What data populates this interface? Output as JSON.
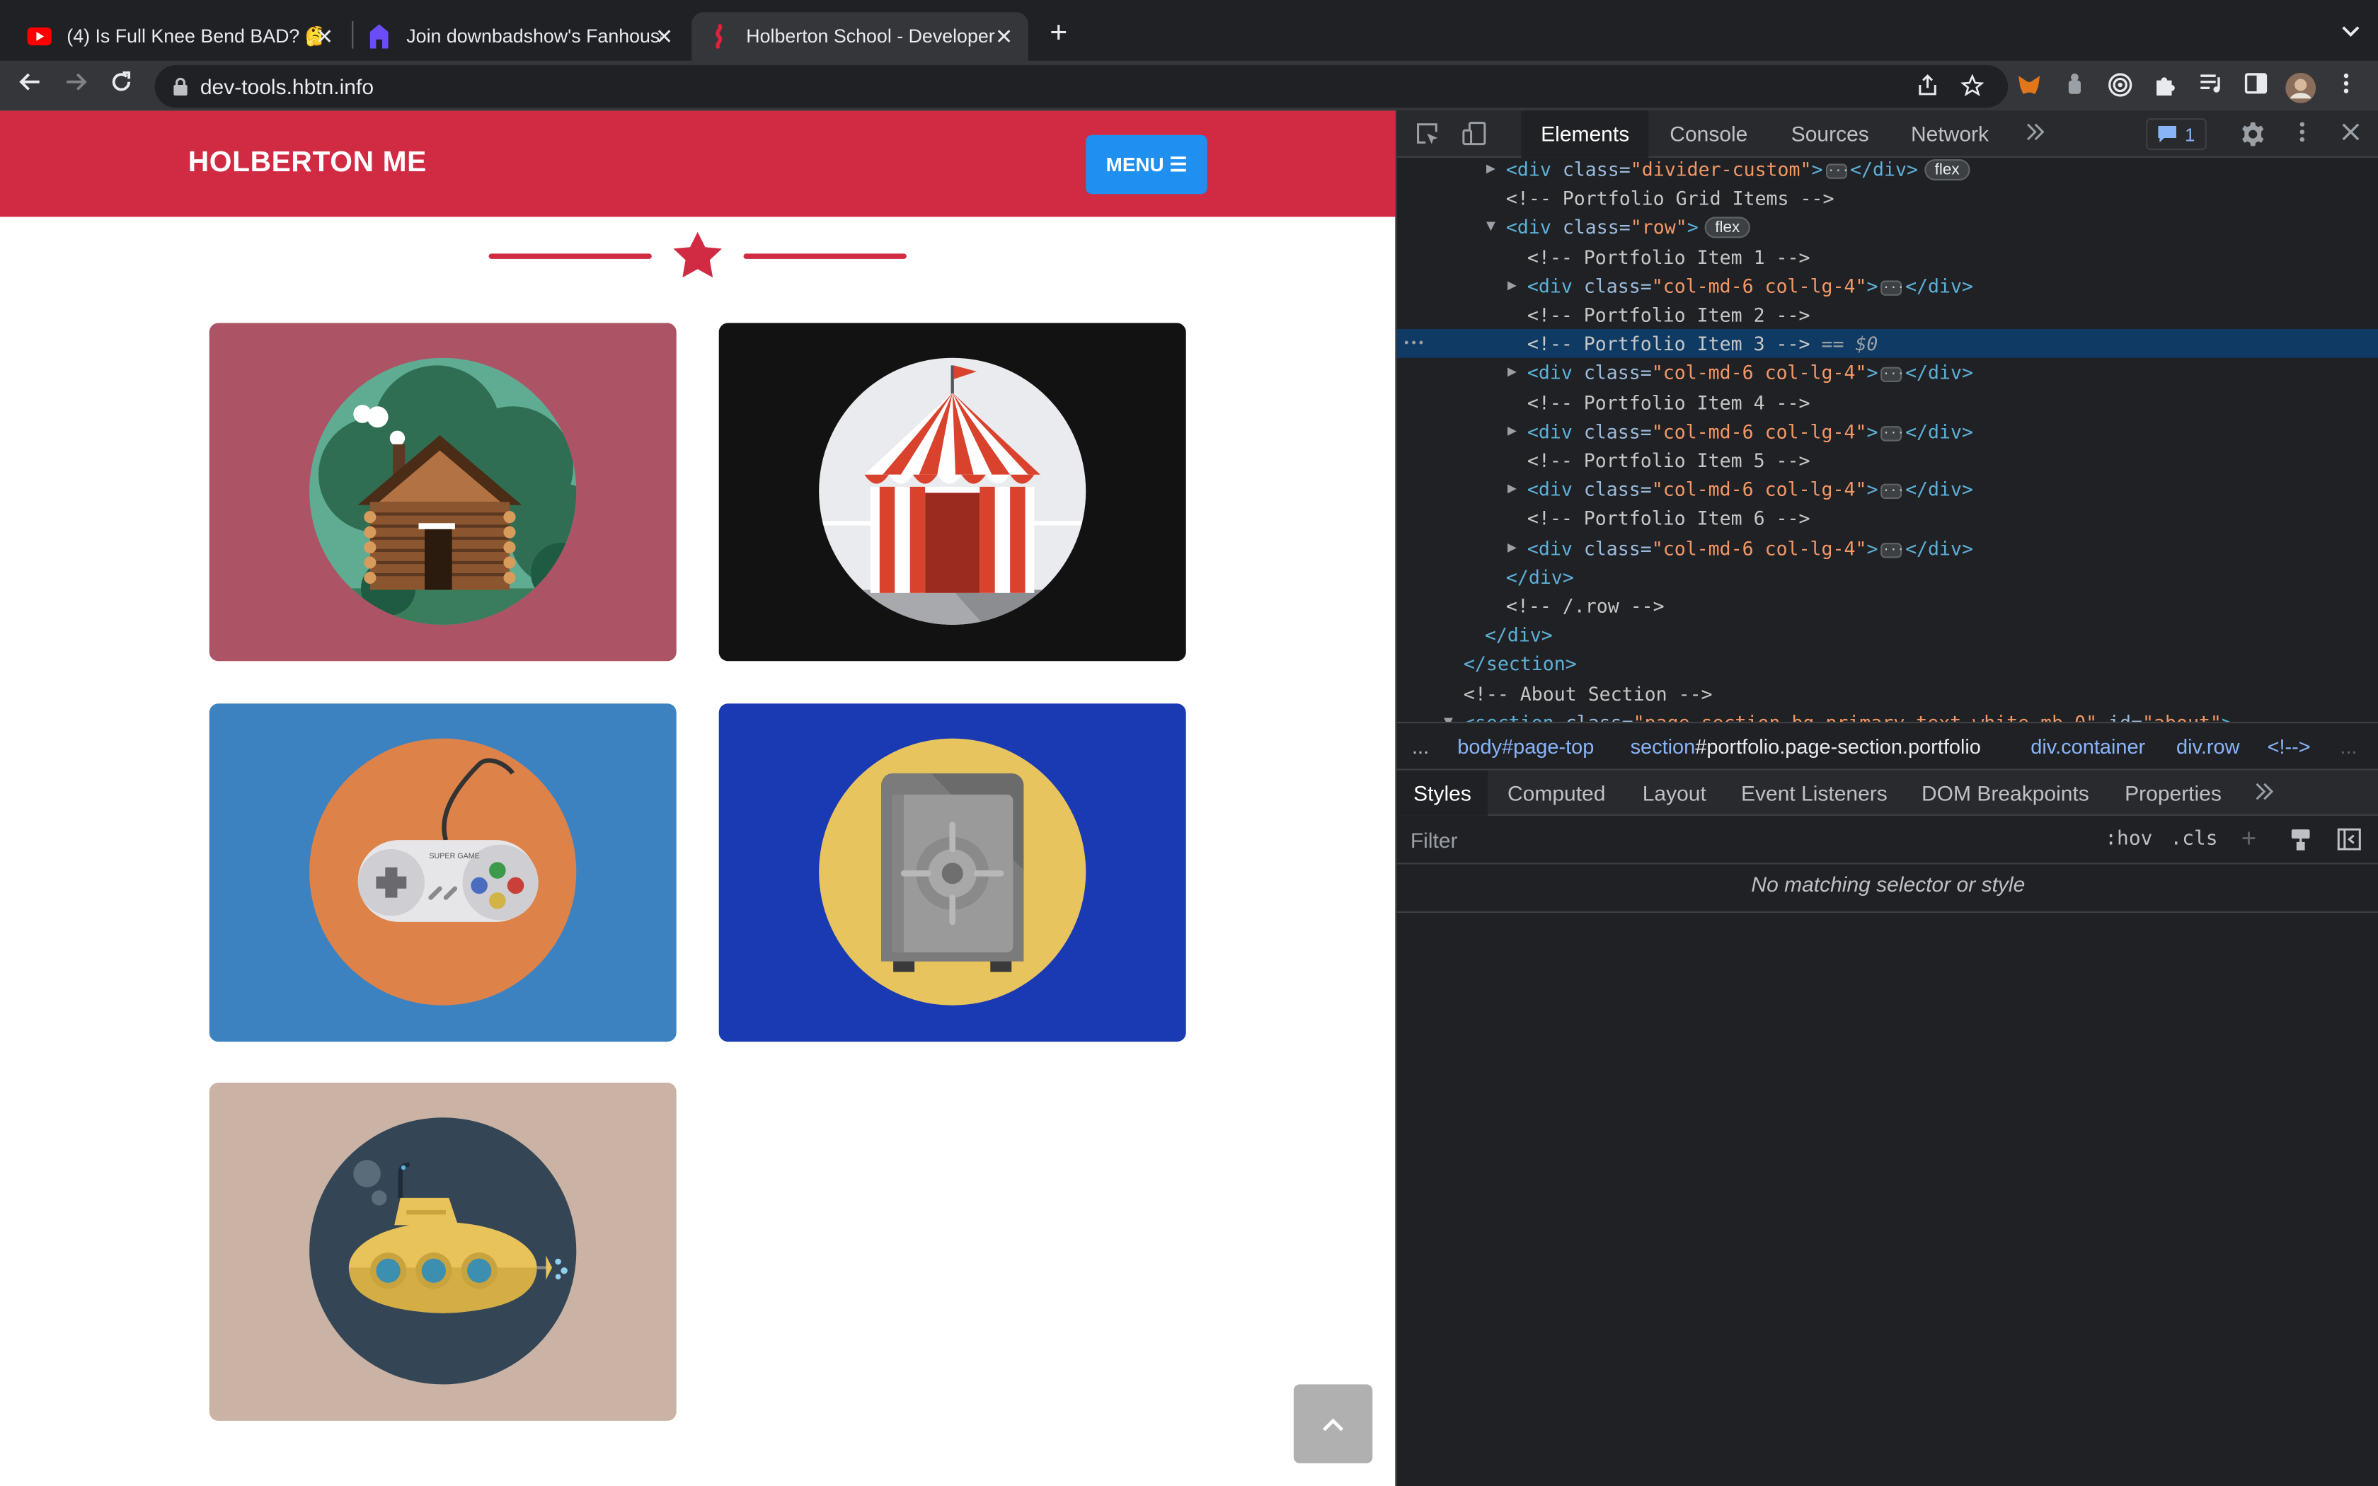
{
  "browser": {
    "tabs": [
      {
        "title": "(4) Is Full Knee Bend BAD? 🤔",
        "icon": "youtube-icon"
      },
      {
        "title": "Join downbadshow's Fanhouse",
        "icon": "fanhouse-icon"
      },
      {
        "title": "Holberton School - Developer t",
        "icon": "holberton-icon"
      }
    ],
    "new_tab_label": "+",
    "close_label": "✕",
    "url": "dev-tools.hbtn.info"
  },
  "page": {
    "brand": "HOLBERTON ME",
    "menu_label": "MENU ☰",
    "colors": {
      "navbar": "#d12a43",
      "menu": "#1f8ff0"
    },
    "portfolio": [
      {
        "icon": "cabin-icon",
        "bg": "#ad5366"
      },
      {
        "icon": "circus-tent-icon",
        "bg": "#121212"
      },
      {
        "icon": "game-controller-icon",
        "bg": "#3d82c0"
      },
      {
        "icon": "safe-icon",
        "bg": "#1a3ab3"
      },
      {
        "icon": "submarine-icon",
        "bg": "#cab3a5"
      }
    ],
    "controller_text": "SUPER GAME"
  },
  "devtools": {
    "tabs": [
      "Elements",
      "Console",
      "Sources",
      "Network"
    ],
    "issues_count": "1",
    "dom_lines": [
      {
        "indent": 4,
        "tri": "▶",
        "parts": [
          [
            "tag",
            "<div "
          ],
          [
            "attr",
            "class="
          ],
          [
            "aval",
            "\"divider-custom\""
          ],
          [
            "tag",
            ">"
          ],
          [
            "ell",
            ""
          ],
          [
            "tag",
            "</div>"
          ],
          [
            "pill",
            "flex"
          ]
        ]
      },
      {
        "indent": 4,
        "tri": "",
        "parts": [
          [
            "cmt",
            "<!-- Portfolio Grid Items -->"
          ]
        ]
      },
      {
        "indent": 4,
        "tri": "▼",
        "parts": [
          [
            "tag",
            "<div "
          ],
          [
            "attr",
            "class="
          ],
          [
            "aval",
            "\"row\""
          ],
          [
            "tag",
            ">"
          ],
          [
            "pill",
            "flex"
          ]
        ]
      },
      {
        "indent": 5,
        "tri": "",
        "parts": [
          [
            "cmt",
            "<!-- Portfolio Item 1 -->"
          ]
        ]
      },
      {
        "indent": 5,
        "tri": "▶",
        "parts": [
          [
            "tag",
            "<div "
          ],
          [
            "attr",
            "class="
          ],
          [
            "aval",
            "\"col-md-6 col-lg-4\""
          ],
          [
            "tag",
            ">"
          ],
          [
            "ell",
            ""
          ],
          [
            "tag",
            "</div>"
          ]
        ]
      },
      {
        "indent": 5,
        "tri": "",
        "parts": [
          [
            "cmt",
            "<!-- Portfolio Item 2 -->"
          ]
        ]
      },
      {
        "indent": 5,
        "tri": "",
        "selected": true,
        "parts": [
          [
            "cmt",
            "<!-- Portfolio Item 3 -->"
          ],
          [
            "eq",
            " == $0"
          ]
        ]
      },
      {
        "indent": 5,
        "tri": "▶",
        "parts": [
          [
            "tag",
            "<div "
          ],
          [
            "attr",
            "class="
          ],
          [
            "aval",
            "\"col-md-6 col-lg-4\""
          ],
          [
            "tag",
            ">"
          ],
          [
            "ell",
            ""
          ],
          [
            "tag",
            "</div>"
          ]
        ]
      },
      {
        "indent": 5,
        "tri": "",
        "parts": [
          [
            "cmt",
            "<!-- Portfolio Item 4 -->"
          ]
        ]
      },
      {
        "indent": 5,
        "tri": "▶",
        "parts": [
          [
            "tag",
            "<div "
          ],
          [
            "attr",
            "class="
          ],
          [
            "aval",
            "\"col-md-6 col-lg-4\""
          ],
          [
            "tag",
            ">"
          ],
          [
            "ell",
            ""
          ],
          [
            "tag",
            "</div>"
          ]
        ]
      },
      {
        "indent": 5,
        "tri": "",
        "parts": [
          [
            "cmt",
            "<!-- Portfolio Item 5 -->"
          ]
        ]
      },
      {
        "indent": 5,
        "tri": "▶",
        "parts": [
          [
            "tag",
            "<div "
          ],
          [
            "attr",
            "class="
          ],
          [
            "aval",
            "\"col-md-6 col-lg-4\""
          ],
          [
            "tag",
            ">"
          ],
          [
            "ell",
            ""
          ],
          [
            "tag",
            "</div>"
          ]
        ]
      },
      {
        "indent": 5,
        "tri": "",
        "parts": [
          [
            "cmt",
            "<!-- Portfolio Item 6 -->"
          ]
        ]
      },
      {
        "indent": 5,
        "tri": "▶",
        "parts": [
          [
            "tag",
            "<div "
          ],
          [
            "attr",
            "class="
          ],
          [
            "aval",
            "\"col-md-6 col-lg-4\""
          ],
          [
            "tag",
            ">"
          ],
          [
            "ell",
            ""
          ],
          [
            "tag",
            "</div>"
          ]
        ]
      },
      {
        "indent": 4,
        "tri": "",
        "parts": [
          [
            "tag",
            "</div>"
          ]
        ]
      },
      {
        "indent": 4,
        "tri": "",
        "parts": [
          [
            "cmt",
            "<!-- /.row -->"
          ]
        ]
      },
      {
        "indent": 3,
        "tri": "",
        "parts": [
          [
            "tag",
            "</div>"
          ]
        ]
      },
      {
        "indent": 2,
        "tri": "",
        "parts": [
          [
            "tag",
            "</section>"
          ]
        ]
      },
      {
        "indent": 2,
        "tri": "",
        "parts": [
          [
            "cmt",
            "<!-- About Section -->"
          ]
        ]
      },
      {
        "indent": 2,
        "tri": "▼",
        "parts": [
          [
            "tag",
            "<section "
          ],
          [
            "attr",
            "class="
          ],
          [
            "aval",
            "\"page-section bg-primary text-white mb-0\""
          ],
          [
            "attr",
            " id="
          ],
          [
            "aval",
            "\"about\""
          ],
          [
            "tag",
            ">"
          ]
        ]
      }
    ],
    "breadcrumbs": [
      {
        "prefix": "body",
        "rest": "#page-top"
      },
      {
        "prefix": "section",
        "rest": "#portfolio.page-section.portfolio"
      },
      {
        "prefix": "div",
        "rest": ".container"
      },
      {
        "prefix": "div",
        "rest": ".row"
      },
      {
        "prefix": "<!--",
        "rest": ">"
      }
    ],
    "breadcrumb_more": "...",
    "style_tabs": [
      "Styles",
      "Computed",
      "Layout",
      "Event Listeners",
      "DOM Breakpoints",
      "Properties"
    ],
    "filter_placeholder": "Filter",
    "hov_label": ":hov",
    "cls_label": ".cls",
    "no_match": "No matching selector or style"
  }
}
